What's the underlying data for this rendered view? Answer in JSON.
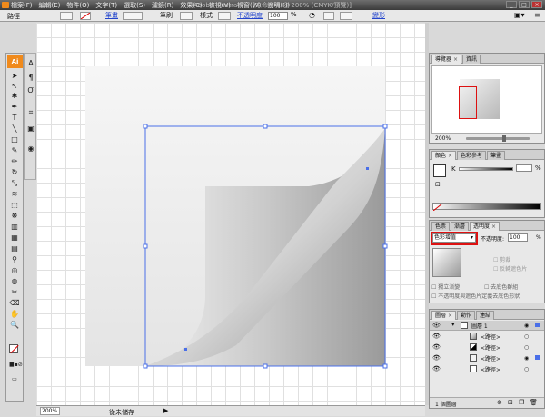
{
  "title_bar": {
    "title": "Adobe Illustrator - [未命名-1 @ 200% (CMYK/預覽)]",
    "menus": [
      "檔案(F)",
      "編輯(E)",
      "物件(O)",
      "文字(T)",
      "選取(S)",
      "濾鏡(R)",
      "效果(C)",
      "檢視(V)",
      "視窗(W)",
      "說明(H)"
    ]
  },
  "control_bar": {
    "selection_label": "路徑",
    "stroke_link": "筆畫",
    "brush_label": "筆刷",
    "style_label": "樣式",
    "opacity_link": "不透明度",
    "opacity_value": "100",
    "percent": "%",
    "transform_link": "變形"
  },
  "toolbox": {
    "badge": "Ai"
  },
  "status_bar": {
    "zoom": "200%",
    "status": "從未儲存"
  },
  "navigator_panel": {
    "tabs": [
      "導覽器",
      "資訊"
    ],
    "zoom": "200%"
  },
  "color_panel": {
    "tabs": [
      "顏色",
      "色彩參考",
      "筆畫"
    ],
    "channel": "K",
    "percent": "%"
  },
  "transparency_panel": {
    "tabs": [
      "色票",
      "漸層",
      "透明度"
    ],
    "blend_mode": "色彩增值",
    "opacity_label": "不透明度:",
    "opacity_value": "100",
    "percent": "%",
    "clip_label": "剪裁",
    "invert_label": "反轉遮色片",
    "isolate_label": "獨立漸變",
    "knockout_label": "去底色群組",
    "define_label": "不透明度與遮色片定義去底色形狀"
  },
  "layers_panel": {
    "tabs": [
      "圖層",
      "動作",
      "連結"
    ],
    "layer_name": "圖層 1",
    "items": [
      "<路徑>",
      "<路徑>",
      "<路徑>",
      "<路徑>"
    ],
    "footer": "1 個圖層"
  },
  "colors": {
    "accent": "#4a6fe8",
    "highlight_box": "#dd1111",
    "ai_orange": "#f08a1c"
  }
}
